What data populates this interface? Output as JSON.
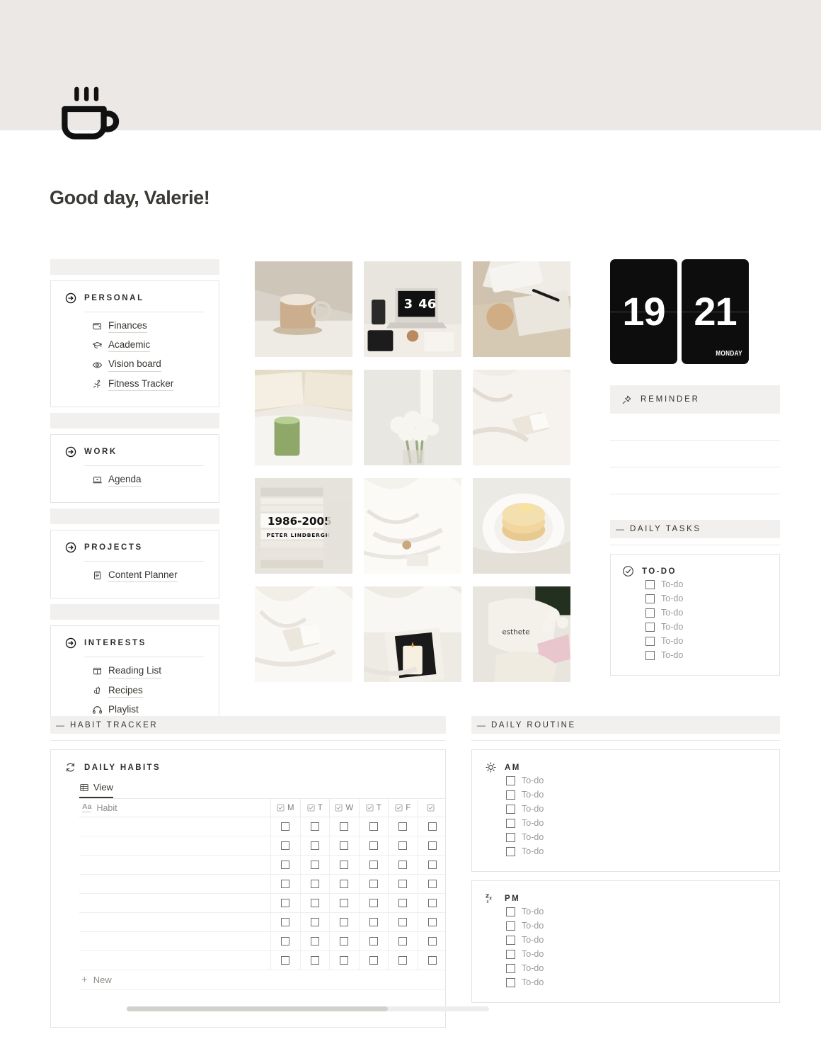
{
  "header": {
    "icon": "coffee-cup-icon",
    "greeting": "Good day, Valerie!"
  },
  "sidebar": {
    "groups": [
      {
        "title": "PERSONAL",
        "icon": "arrow-right-circle-icon",
        "items": [
          {
            "label": "Finances",
            "icon": "wallet-icon"
          },
          {
            "label": "Academic",
            "icon": "graduation-cap-icon"
          },
          {
            "label": "Vision board",
            "icon": "eye-icon"
          },
          {
            "label": "Fitness Tracker",
            "icon": "running-person-icon"
          }
        ]
      },
      {
        "title": "WORK",
        "icon": "arrow-right-circle-icon",
        "items": [
          {
            "label": "Agenda",
            "icon": "laptop-icon"
          }
        ]
      },
      {
        "title": "PROJECTS",
        "icon": "arrow-right-circle-icon",
        "items": [
          {
            "label": "Content Planner",
            "icon": "notepad-icon"
          }
        ]
      },
      {
        "title": "INTERESTS",
        "icon": "arrow-right-circle-icon",
        "items": [
          {
            "label": "Reading List",
            "icon": "book-icon"
          },
          {
            "label": "Recipes",
            "icon": "blender-icon"
          },
          {
            "label": "Playlist",
            "icon": "headphones-icon"
          }
        ]
      }
    ]
  },
  "gallery": {
    "images": [
      {
        "alt": "iced latte in glass mug on white table"
      },
      {
        "alt": "laptop showing flip clock 3:46 on desk with tablet and coffee"
      },
      {
        "alt": "keyboard, open book and iced coffee on desk"
      },
      {
        "alt": "open book and iced matcha on white bedsheets"
      },
      {
        "alt": "white tulips in glass vase with sunlight stripes"
      },
      {
        "alt": "open book on white crumpled bedding"
      },
      {
        "alt": "stack of photography books, 1986-2005 Peter Lindbergh"
      },
      {
        "alt": "white rumpled bedsheets with small object"
      },
      {
        "alt": "stack of pancakes with butter on white plate"
      },
      {
        "alt": "open book on white sunlit bedsheets"
      },
      {
        "alt": "lit candle on magazine over white bedding"
      },
      {
        "alt": "esthete tote bag with flowers and open book"
      }
    ]
  },
  "clock": {
    "hours": "19",
    "minutes": "21",
    "weekday": "MONDAY"
  },
  "reminder": {
    "label": "REMINDER",
    "icon": "pushpin-icon",
    "lines": [
      "",
      "",
      ""
    ]
  },
  "daily_tasks": {
    "section_label": "DAILY TASKS",
    "dash": "—",
    "card": {
      "title": "TO-DO",
      "icon": "check-circle-icon",
      "items": [
        "To-do",
        "To-do",
        "To-do",
        "To-do",
        "To-do",
        "To-do"
      ]
    }
  },
  "habit_tracker": {
    "section_label": "HABIT TRACKER",
    "dash": "—",
    "card_title": "DAILY HABITS",
    "card_icon": "sync-icon",
    "view_tab": "View",
    "view_icon": "table-grid-icon",
    "name_column": {
      "type_glyph": "Aa",
      "label": "Habit"
    },
    "day_columns": [
      "M",
      "T",
      "W",
      "T",
      "F",
      ""
    ],
    "row_count": 8,
    "new_row_label": "New",
    "scroll_thumb_percent": 72
  },
  "daily_routine": {
    "section_label": "DAILY ROUTINE",
    "dash": "—",
    "blocks": [
      {
        "title": "AM",
        "icon": "sun-icon",
        "items": [
          "To-do",
          "To-do",
          "To-do",
          "To-do",
          "To-do",
          "To-do"
        ]
      },
      {
        "title": "PM",
        "icon": "sleep-zzz-icon",
        "items": [
          "To-do",
          "To-do",
          "To-do",
          "To-do",
          "To-do",
          "To-do"
        ]
      }
    ]
  },
  "colors": {
    "cover": "#ece8e5",
    "band": "#f1f0ee",
    "border": "#e6e4e1",
    "text": "#37352f",
    "muted": "#9b9a96",
    "clock_bg": "#0d0d0d"
  }
}
